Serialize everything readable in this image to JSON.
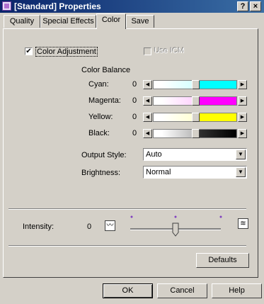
{
  "window": {
    "title": "[Standard] Properties",
    "help_label": "?",
    "close_label": "×"
  },
  "tabs": [
    {
      "label": "Quality"
    },
    {
      "label": "Special Effects"
    },
    {
      "label": "Color",
      "active": true
    },
    {
      "label": "Save"
    }
  ],
  "color_adjustment": {
    "label": "Color Adjustment",
    "checked": true,
    "check_mark": "✔"
  },
  "use_icm": {
    "label": "Use ICM",
    "checked": false,
    "disabled": true
  },
  "color_balance": {
    "heading": "Color Balance",
    "channels": [
      {
        "label": "Cyan:",
        "value": "0",
        "color": "#00ffff"
      },
      {
        "label": "Magenta:",
        "value": "0",
        "color": "#ff00ff"
      },
      {
        "label": "Yellow:",
        "value": "0",
        "color": "#ffff00"
      },
      {
        "label": "Black:",
        "value": "0",
        "color": "#000000"
      }
    ],
    "slider_position": 0.5
  },
  "output_style": {
    "label": "Output Style:",
    "value": "Auto"
  },
  "brightness": {
    "label": "Brightness:",
    "value": "Normal"
  },
  "intensity": {
    "label": "Intensity:",
    "value": "0",
    "position": 0.5
  },
  "buttons": {
    "defaults": "Defaults",
    "ok": "OK",
    "cancel": "Cancel",
    "help": "Help"
  },
  "arrows": {
    "left": "◀",
    "right": "▶",
    "down": "▼"
  }
}
